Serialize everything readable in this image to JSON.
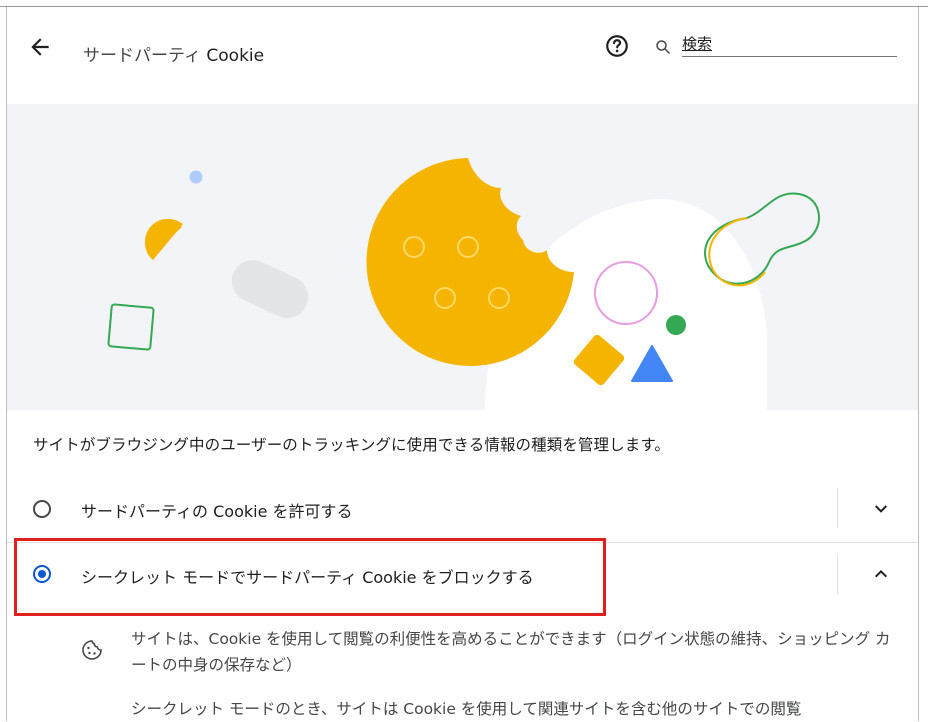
{
  "header": {
    "back_icon": "arrow-left-icon",
    "title_prefix": "サードパーティ ",
    "title_cookie": "Cookie",
    "help_icon": "help-circle-icon",
    "search_icon": "search-icon",
    "search_placeholder": "検索"
  },
  "banner": {
    "illustration": "cookie-illustration",
    "colors": {
      "background": "#f3f4f7",
      "cookie": "#f4b400",
      "blue_shape": "#4285f4",
      "green_shape": "#34a853",
      "pink_ring": "#e89be3",
      "grey_pill": "#e3e5e8",
      "light_blue_dot": "#aecbfa"
    }
  },
  "description": "サイトがブラウジング中のユーザーのトラッキングに使用できる情報の種類を管理します。",
  "options": [
    {
      "label": "サードパーティの Cookie を許可する",
      "selected": false,
      "expand_icon": "chevron-down-icon"
    },
    {
      "label": "シークレット モードでサードパーティ Cookie をブロックする",
      "selected": true,
      "expand_icon": "chevron-up-icon"
    }
  ],
  "details": [
    {
      "icon": "cookie-icon",
      "text": "サイトは、Cookie を使用して閲覧の利便性を高めることができます（ログイン状態の維持、ショッピング カートの中身の保存など）"
    },
    {
      "text": "シークレット モードのとき、サイトは Cookie を使用して関連サイトを含む他のサイトでの閲覧"
    }
  ],
  "colors": {
    "accent": "#0b57d0",
    "highlight": "#e0201b",
    "text": "#1f1f1f",
    "secondary_text": "#444746"
  }
}
